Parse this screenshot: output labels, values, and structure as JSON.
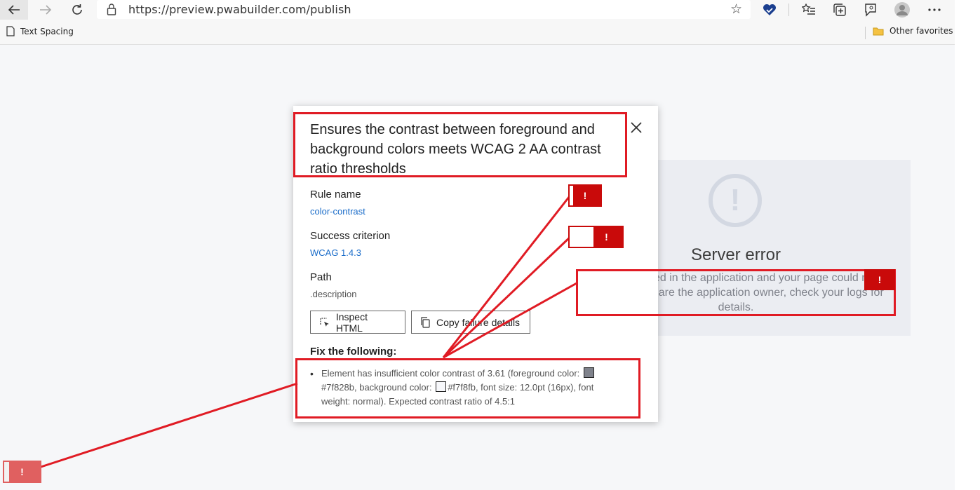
{
  "browser": {
    "url": "https://preview.pwabuilder.com/publish",
    "favorites": [
      {
        "label": "Text Spacing"
      }
    ],
    "other_favorites": "Other favorites"
  },
  "dialog": {
    "title": "Ensures the contrast between foreground and background colors meets WCAG 2 AA contrast ratio thresholds",
    "rule_name_label": "Rule name",
    "rule_name_value": "color-contrast",
    "success_label": "Success criterion",
    "success_value": "WCAG 1.4.3",
    "path_label": "Path",
    "path_value": ".description",
    "inspect_button": "Inspect HTML",
    "copy_button": "Copy failure details",
    "fix_title": "Fix the following:",
    "fix_items": [
      {
        "part1": "Element has insufficient color contrast of 3.61 (foreground color: ",
        "fg": "#7f828b",
        "part2": ", background color: ",
        "bg": "#f7f8fb",
        "part3": ", font size: 12.0pt (16px), font weight: normal). Expected contrast ratio of 4.5:1"
      }
    ]
  },
  "server_error": {
    "title": "Server error",
    "message": "An error occurred in the application and your page could not be served. If you are the application owner, check your logs for details."
  },
  "annotations": {
    "flag_symbol": "!",
    "highlight_color": "#e01b24",
    "flag_color": "#c90a0a"
  }
}
